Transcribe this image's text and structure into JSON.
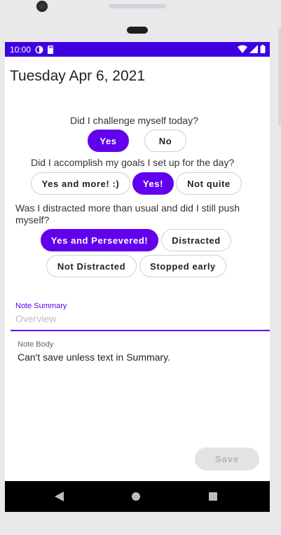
{
  "status_bar": {
    "time": "10:00"
  },
  "header": {
    "date": "Tuesday Apr 6, 2021"
  },
  "question1": {
    "text": "Did I challenge myself today?",
    "options": [
      "Yes",
      "No"
    ],
    "selected": "Yes"
  },
  "question2": {
    "text": "Did I accomplish my goals I set up for the day?",
    "options": [
      "Yes and more! :)",
      "Yes!",
      "Not quite"
    ],
    "selected": "Yes!"
  },
  "question3": {
    "text_line1": "Was I distracted more than usual and did I still push",
    "text_line2": "myself?",
    "options": [
      "Yes and Persevered!",
      "Distracted",
      "Not Distracted",
      "Stopped early"
    ],
    "selected": "Yes and Persevered!"
  },
  "note_summary": {
    "label": "Note Summary",
    "placeholder": "Overview"
  },
  "note_body": {
    "label": "Note Body",
    "text": "Can't save unless text in Summary."
  },
  "save_button": {
    "label": "Save"
  },
  "colors": {
    "accent": "#6200ee",
    "status_bar": "#3d00e0"
  }
}
